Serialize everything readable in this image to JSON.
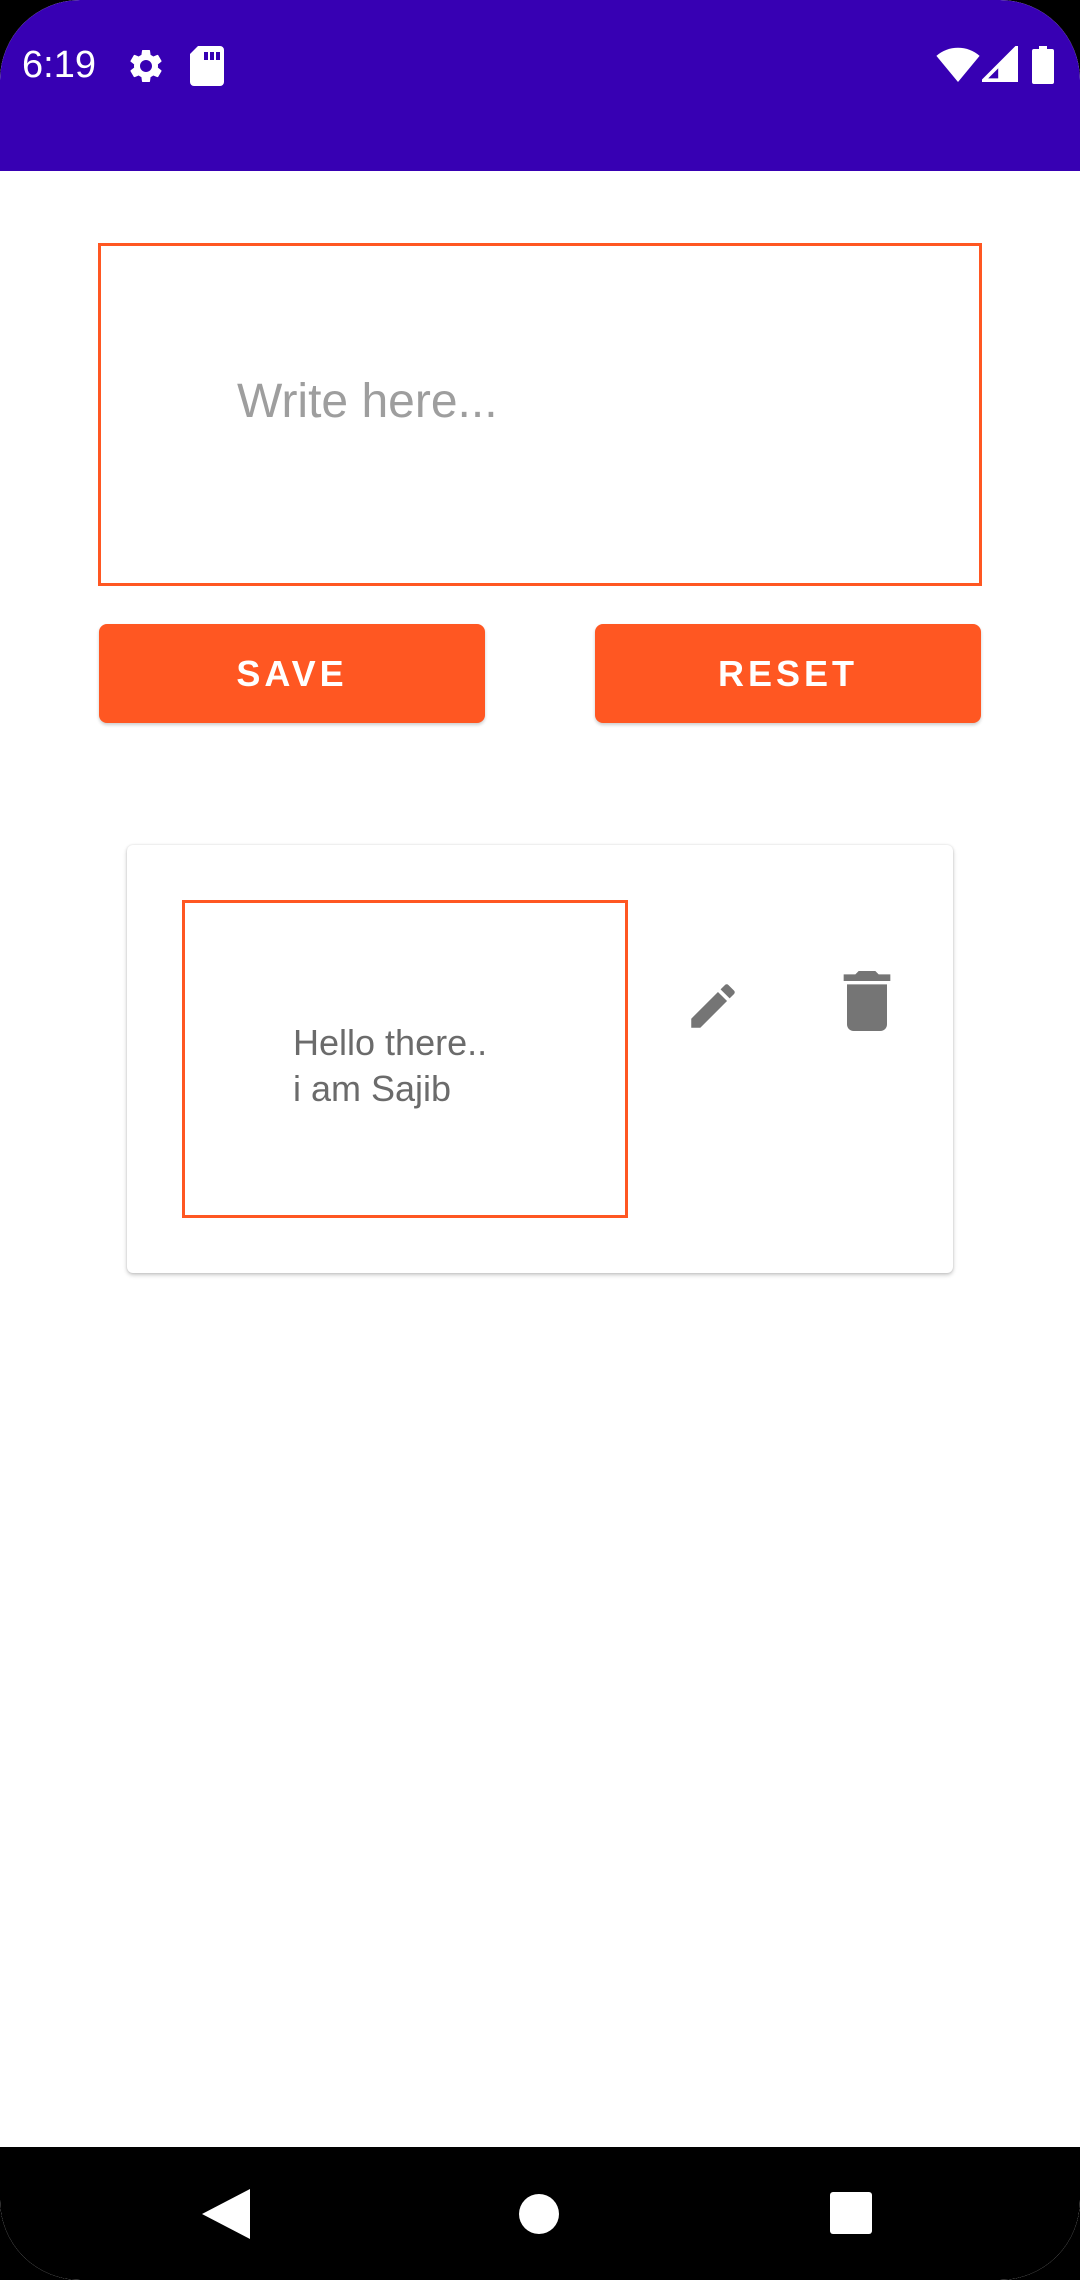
{
  "status_bar": {
    "time": "6:19",
    "background": "#3700b3",
    "icons": [
      "gear-icon",
      "sd-card-icon",
      "wifi-icon",
      "signal-icon",
      "battery-icon"
    ]
  },
  "editor": {
    "placeholder": "Write here...",
    "value": ""
  },
  "buttons": {
    "save_label": "SAVE",
    "reset_label": "RESET",
    "color": "#ff5722"
  },
  "notes": [
    {
      "text": "Hello there..\ni am Sajib",
      "actions": [
        "edit-icon",
        "delete-icon"
      ]
    }
  ],
  "nav_bar": {
    "icons": [
      "back-icon",
      "home-icon",
      "recents-icon"
    ]
  }
}
